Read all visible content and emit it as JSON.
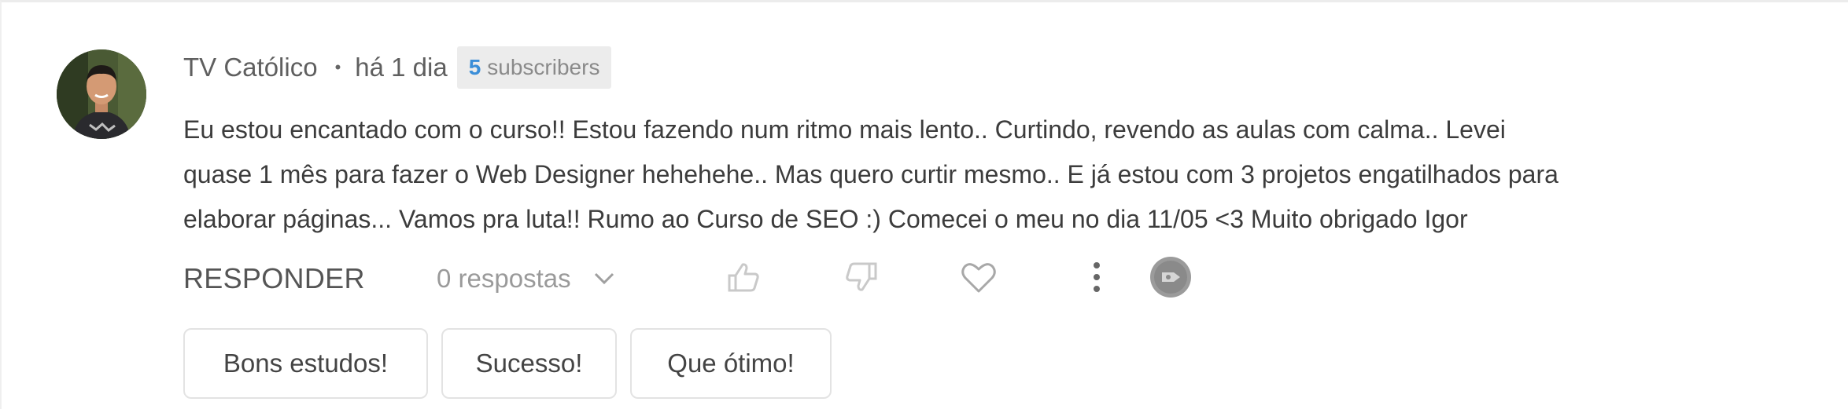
{
  "comment": {
    "author": "TV Católico",
    "separator": "•",
    "time": "há 1 dia",
    "subscribers_count": "5",
    "subscribers_label": "subscribers",
    "text": "Eu estou encantado com o curso!! Estou fazendo num ritmo mais lento.. Curtindo, revendo as aulas com calma.. Levei\nquase 1 mês para fazer o Web Designer hehehehe.. Mas quero curtir mesmo.. E já estou com 3 projetos engatilhados para\nelaborar páginas... Vamos pra luta!! Rumo ao Curso de SEO :) Comecei o meu no dia 11/05 <3 Muito obrigado Igor"
  },
  "actions": {
    "reply_label": "RESPONDER",
    "replies_label": "0 respostas",
    "icons": [
      "chevron-down-icon",
      "thumbs-up-icon",
      "thumbs-down-icon",
      "heart-icon",
      "more-vertical-icon",
      "share-icon"
    ]
  },
  "quick_replies": [
    "Bons estudos!",
    "Sucesso!",
    "Que ótimo!"
  ],
  "colors": {
    "subscribers_count": "#3b8ed8",
    "badge_bg": "#ececec",
    "text": "#3c3c3c",
    "muted": "#9a9a9a"
  }
}
